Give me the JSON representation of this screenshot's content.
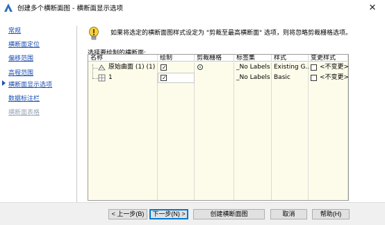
{
  "window": {
    "title": "创建多个横断面图 - 横断面显示选项",
    "close_glyph": "✕"
  },
  "sidebar": {
    "items": [
      {
        "label": "常规",
        "state": "link"
      },
      {
        "label": "横断面定位",
        "state": "link"
      },
      {
        "label": "偏移范围",
        "state": "link"
      },
      {
        "label": "高程范围",
        "state": "link"
      },
      {
        "label": "横断面显示选项",
        "state": "current"
      },
      {
        "label": "数据标注栏",
        "state": "link"
      },
      {
        "label": "横断面表格",
        "state": "disabled"
      }
    ]
  },
  "info": {
    "icon": "lightbulb-icon",
    "text": "如果将选定的横断面图样式设定为 \"剪裁至最高横断面\" 选项，则将忽略剪裁栅格选项。"
  },
  "table": {
    "label": "选择要绘制的横断面:",
    "columns": [
      "名称",
      "绘制",
      "剪裁栅格",
      "标签集",
      "样式",
      "变更样式"
    ],
    "rows": [
      {
        "name": "原始曲面 (1) (1)",
        "icon": "surface-icon",
        "draw": true,
        "clip_grid": true,
        "label_set": "_No Labels",
        "style": "Existing G...",
        "change_style_checked": false,
        "change_style_text": "<不变更>"
      },
      {
        "name": "1",
        "icon": "corridor-icon",
        "draw": true,
        "clip_grid": false,
        "label_set": "_No Labels",
        "style": "Basic",
        "change_style_checked": false,
        "change_style_text": "<不变更>"
      }
    ]
  },
  "buttons": {
    "back": "< 上一步(B)",
    "next": "下一步(N) >",
    "create": "创建横断面图",
    "cancel": "取消",
    "help": "帮助(H)"
  },
  "colors": {
    "accent": "#0078d7",
    "link": "#1a4fb4",
    "disabled": "#9aa6b8",
    "cell_bg": "#fdfcea"
  }
}
